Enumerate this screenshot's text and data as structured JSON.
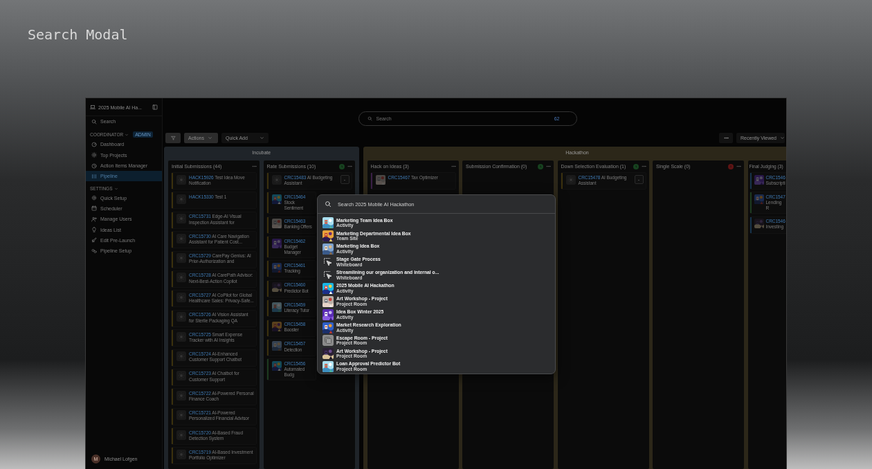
{
  "page_title": "Search Modal",
  "sidebar": {
    "workspace": "2025 Mobile AI Ha...",
    "search": "Search",
    "sections": [
      {
        "label": "COORDINATOR",
        "badge": "ADMIN",
        "items": [
          {
            "label": "Dashboard",
            "selected": false
          },
          {
            "label": "Top Projects",
            "selected": false
          },
          {
            "label": "Action Items Manager",
            "selected": false
          },
          {
            "label": "Pipeline",
            "selected": true
          }
        ]
      },
      {
        "label": "SETTINGS",
        "items": [
          {
            "label": "Quick Setup",
            "selected": false
          },
          {
            "label": "Scheduler",
            "selected": false
          },
          {
            "label": "Manage Users",
            "selected": false
          },
          {
            "label": "Ideas List",
            "selected": false
          },
          {
            "label": "Edit Pre-Launch",
            "selected": false
          },
          {
            "label": "Pipeline Setup",
            "selected": false
          }
        ]
      }
    ],
    "user": {
      "initial": "M",
      "name": "Michael Lofgen"
    }
  },
  "top_search": {
    "placeholder": "Search",
    "badge": "62"
  },
  "toolbar": {
    "actions": "Actions",
    "quick_add": "Quick Add",
    "sort": "Recently Viewed"
  },
  "stages": [
    {
      "name": "Incubate",
      "color": "#1f2429",
      "columns": [
        {
          "title": "Initial Submissions (44)",
          "cards": [
            {
              "id": "HACK15926",
              "title": "Test Idea Move Notification",
              "color": "#3b300d",
              "kind": "placeholder"
            },
            {
              "id": "HACK15330",
              "title": "Test 1",
              "color": "#3b300d",
              "kind": "placeholder"
            },
            {
              "id": "CRC15731",
              "title": "Edge-AI Visual Inspection Assistant for",
              "color": "#3b300d",
              "kind": "placeholder"
            },
            {
              "id": "CRC15730",
              "title": "AI Care Navigation Assistant for Patient Cost...",
              "color": "#3b300d",
              "kind": "placeholder"
            },
            {
              "id": "CRC15729",
              "title": "CarePay Genius: AI Prior-Authorization and",
              "color": "#3b300d",
              "kind": "placeholder"
            },
            {
              "id": "CRC15728",
              "title": "AI CarePath Advisor: Next-Best-Action Copilot",
              "color": "#3b300d",
              "kind": "placeholder"
            },
            {
              "id": "CRC15727",
              "title": "AI CoPilot for Global Healthcare Sales: Privacy-Safe...",
              "color": "#3b300d",
              "kind": "placeholder"
            },
            {
              "id": "CRC15726",
              "title": "AI Vision Assistant for Sterile Packaging QA",
              "color": "#3b300d",
              "kind": "placeholder"
            },
            {
              "id": "CRC15725",
              "title": "Smart Expense Tracker with AI Insights",
              "color": "#3b300d",
              "kind": "placeholder"
            },
            {
              "id": "CRC15724",
              "title": "AI-Enhanced Customer Support Chatbot",
              "color": "#3b300d",
              "kind": "placeholder"
            },
            {
              "id": "CRC15723",
              "title": "AI Chatbot for Customer Support",
              "color": "#3b300d",
              "kind": "placeholder"
            },
            {
              "id": "CRC15722",
              "title": "AI-Powered Personal Finance Coach",
              "color": "#3b300d",
              "kind": "placeholder"
            },
            {
              "id": "CRC15721",
              "title": "AI-Powered Personalized Financial Advisor",
              "color": "#3b300d",
              "kind": "placeholder"
            },
            {
              "id": "CRC15720",
              "title": "AI-Based Fraud Detection System",
              "color": "#3b300d",
              "kind": "placeholder"
            },
            {
              "id": "CRC15719",
              "title": "AI-Based Investment Portfolio Optimizer",
              "color": "#3b300d",
              "kind": "placeholder"
            }
          ]
        },
        {
          "title": "Rate Submissions (10)",
          "kind": "clock",
          "cards": [
            {
              "id": "CRC15483",
              "title": "AI Budgeting\nAssistant",
              "color": "#3b300d",
              "kind": "placeholder",
              "button": "-"
            },
            {
              "id": "CRC15464",
              "title": "Stock Sentiment",
              "color": "#3b300d",
              "kind": "picture"
            },
            {
              "id": "CRC15463",
              "title": "Banking Offers",
              "color": "#3b300d",
              "kind": "picture"
            },
            {
              "id": "CRC15462",
              "title": "Budget Manager",
              "color": "#3b300d",
              "kind": "picture"
            },
            {
              "id": "CRC15461",
              "title": "Tracking",
              "color": "#3b300d",
              "kind": "picture"
            },
            {
              "id": "CRC15460",
              "title": "Predictor Bot",
              "color": "#3b300d",
              "kind": "picture"
            },
            {
              "id": "CRC15459",
              "title": "Literacy Tutor",
              "color": "#3b300d",
              "kind": "picture"
            },
            {
              "id": "CRC15458",
              "title": "Booster",
              "color": "#3b300d",
              "kind": "picture"
            },
            {
              "id": "CRC15457",
              "title": "Detection",
              "color": "#3b300d",
              "kind": "picture"
            },
            {
              "id": "CRC15456",
              "title": "Automated Budg",
              "color": "#1c3a1f",
              "kind": "picture"
            }
          ]
        }
      ]
    },
    {
      "name": "Hackathon",
      "color": "#2c2719",
      "columns": [
        {
          "title": "Hack on Ideas (3)",
          "cards": [
            {
              "id": "CRC15467",
              "title": "Tax Optimizer",
              "color": "#3a1f46",
              "kind": "picture"
            }
          ]
        },
        {
          "title": "Submission Confirmation (0)",
          "kind": "clock"
        },
        {
          "title": "Down Selection Evaluation (1)",
          "kind": "clock",
          "cards": [
            {
              "id": "CRC15478",
              "title": "AI Budgeting\nAssistant",
              "color": "#3b300d",
              "kind": "placeholder",
              "button": "-"
            }
          ]
        },
        {
          "title": "Single Scale (0)",
          "kind": "alert"
        },
        {
          "title": "Final Judging (3)",
          "cards": [
            {
              "id": "CRC1546",
              "title": "Subscripti",
              "color": "#16324a",
              "kind": "picture"
            },
            {
              "id": "CRC1547",
              "title": "Lending R",
              "color": "#1c3a1f",
              "kind": "picture"
            },
            {
              "id": "CRC1546",
              "title": "Investing",
              "color": "#16324a",
              "kind": "picture"
            }
          ]
        }
      ]
    }
  ],
  "search_modal": {
    "placeholder": "Search 2025 Mobile AI Hackathon",
    "results": [
      {
        "title": "Marketing Team Idea Box",
        "type": "Activity",
        "kind": "picture"
      },
      {
        "title": "Marketing Departmental Idea Box",
        "type": "Team Site",
        "kind": "picture"
      },
      {
        "title": "Marketing Idea Box",
        "type": "Activity",
        "kind": "picture"
      },
      {
        "title": "Stage Gate Process",
        "type": "Whiteboard",
        "kind": "whiteboard"
      },
      {
        "title": "Streamlining our organization and internal o...",
        "type": "Whiteboard",
        "kind": "whiteboard"
      },
      {
        "title": "2025 Mobile AI Hackathon",
        "type": "Activity",
        "kind": "picture"
      },
      {
        "title": "Art Workshop - Project",
        "type": "Project Room",
        "kind": "picture"
      },
      {
        "title": "Idea Box Winter 2025",
        "type": "Activity",
        "kind": "picture"
      },
      {
        "title": "Market Research Exploration",
        "type": "Activity",
        "kind": "picture"
      },
      {
        "title": "Escape Room - Project",
        "type": "Project Room",
        "kind": "rooms"
      },
      {
        "title": "Art Workshop - Project",
        "type": "Project Room",
        "kind": "picture"
      },
      {
        "title": "Loan Approval Predictor Bot",
        "type": "Project Room",
        "kind": "picture"
      }
    ]
  }
}
